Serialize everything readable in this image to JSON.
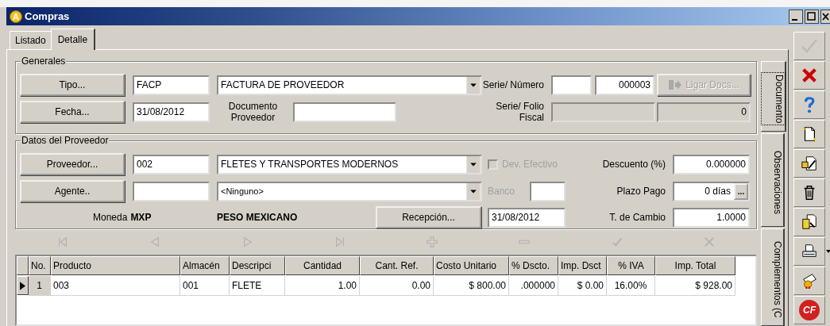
{
  "window": {
    "icon_label": "A",
    "title": "Compras"
  },
  "tabs": [
    {
      "label": "Listado",
      "selected": false
    },
    {
      "label": "Detalle",
      "selected": true
    }
  ],
  "generales": {
    "title": "Generales",
    "tipo_button": "Tipo...",
    "tipo_code": "FACP",
    "tipo_name": "FACTURA DE PROVEEDOR",
    "fecha_button": "Fecha...",
    "fecha": "31/08/2012",
    "documento_label": "Documento Proveedor",
    "serie_numero_label": "Serie/ Número",
    "numero": "000003",
    "ligar_button": {
      "label": "Ligar Docs...",
      "disabled": true
    },
    "folio_label": "Serie/ Folio Fiscal",
    "folio_serie": {
      "disabled": true
    },
    "folio": {
      "value": "0",
      "disabled": true
    }
  },
  "proveedor": {
    "title": "Datos del Proveedor",
    "proveedor_button": "Proveedor...",
    "code": "002",
    "name": "FLETES Y TRANSPORTES MODERNOS",
    "agente_button": "Agente..",
    "agente_name": "<Ninguno>",
    "moneda_label": "Moneda",
    "moneda": "MXP",
    "moneda_name": "PESO MEXICANO",
    "recepcion_button": "Recepción...",
    "recepcion": "31/08/2012",
    "dev_efectivo": {
      "label": "Dev. Efectivo",
      "checked": false,
      "disabled": true
    },
    "banco": {
      "label": "Banco",
      "disabled": true
    },
    "descuento_label": "Descuento (%)",
    "descuento": "0.000000",
    "plazo_label": "Plazo Pago",
    "plazo": "0 días",
    "plazo_button": "...",
    "cambio_label": "T. de Cambio",
    "cambio": "1.0000"
  },
  "navigator": [
    {
      "kind": "first",
      "disabled": true
    },
    {
      "kind": "prev",
      "disabled": true
    },
    {
      "kind": "next",
      "disabled": true
    },
    {
      "kind": "last",
      "disabled": true
    },
    {
      "kind": "add",
      "disabled": true
    },
    {
      "kind": "remove",
      "disabled": true
    },
    {
      "kind": "confirm",
      "disabled": true
    },
    {
      "kind": "cancel",
      "disabled": true
    }
  ],
  "grid": {
    "columns": [
      "No.",
      "Producto",
      "Almacén",
      "Descripci",
      "Cantidad",
      "Cant. Ref.",
      "Costo Unitario",
      "% Dscto.",
      "Imp. Dsct",
      "% IVA",
      "Imp. Total"
    ],
    "rows": [
      {
        "selected": true,
        "cells": [
          "1",
          "003",
          "001",
          "FLETE",
          "1.00",
          "0.00",
          "$ 800.00",
          ".000000",
          "$ 0.00",
          "16.00%",
          "$ 928.00"
        ]
      }
    ]
  },
  "side_tabs": [
    {
      "label": "Documento",
      "selected": true
    },
    {
      "label": "Observaciones",
      "selected": false
    },
    {
      "label": "Complementos (C",
      "selected": false
    }
  ],
  "toolbar": [
    {
      "kind": "accept",
      "disabled": true
    },
    {
      "kind": "cancel",
      "disabled": false
    },
    {
      "kind": "help",
      "disabled": false
    },
    {
      "kind": "new",
      "disabled": false
    },
    {
      "kind": "edit",
      "disabled": false
    },
    {
      "kind": "delete",
      "disabled": false
    },
    {
      "kind": "copy",
      "disabled": false
    },
    {
      "kind": "print",
      "disabled": false
    },
    {
      "kind": "certificate",
      "disabled": false
    },
    {
      "kind": "cfd",
      "disabled": false,
      "label": "CF"
    }
  ]
}
